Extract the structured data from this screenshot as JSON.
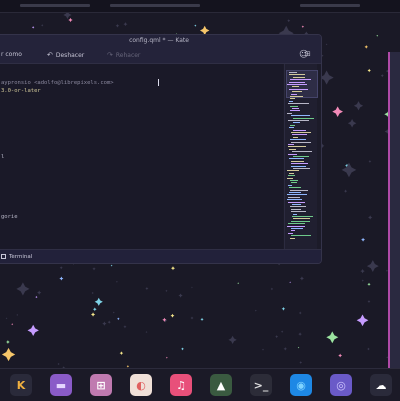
{
  "window": {
    "title": "config.qml * — Kate"
  },
  "toolbar": {
    "save_as_label": "r como",
    "undo_label": "Deshacer",
    "redo_label": "Rehacer",
    "undo_icon": "undo-icon",
    "redo_icon": "redo-icon",
    "overflow_icon": "overflow-menu-icon",
    "split_icon": "split-view-icon"
  },
  "editor": {
    "lines": [
      "aypronsio <adolfo@librepixels.com>",
      "3.0-or-later",
      "l",
      "gorie"
    ]
  },
  "statusbar": {
    "terminal_label": "Terminal"
  },
  "dock": {
    "items": [
      {
        "name": "kde-connect-icon",
        "glyph": "K",
        "bg": "#2a2a3a",
        "fg": "#f0b040"
      },
      {
        "name": "files-icon",
        "glyph": "▬",
        "bg": "#8a5bc8",
        "fg": "#e5d5ff"
      },
      {
        "name": "store-icon",
        "glyph": "⊞",
        "bg": "#c07ab0",
        "fg": "#ffffff"
      },
      {
        "name": "krita-icon",
        "glyph": "◐",
        "bg": "#f0e0d8",
        "fg": "#e06060"
      },
      {
        "name": "music-icon",
        "glyph": "♫",
        "bg": "#e8507a",
        "fg": "#ffffff"
      },
      {
        "name": "image-viewer-icon",
        "glyph": "▲",
        "bg": "#3a5a40",
        "fg": "#ffffff"
      },
      {
        "name": "terminal-icon",
        "glyph": ">_",
        "bg": "#2c2c38",
        "fg": "#e0e0e0"
      },
      {
        "name": "browser-icon",
        "glyph": "◉",
        "bg": "#1e88e5",
        "fg": "#7fd4ff"
      },
      {
        "name": "settings-icon",
        "glyph": "◎",
        "bg": "#6a5ac8",
        "fg": "#d0c8ff"
      },
      {
        "name": "cloud-icon",
        "glyph": "☁",
        "bg": "#2a2a3a",
        "fg": "#ffffff"
      }
    ]
  },
  "colors": {
    "wallpaper": "#1a1926",
    "window_bg": "#1c1b29",
    "accent": "#b04aa8"
  }
}
